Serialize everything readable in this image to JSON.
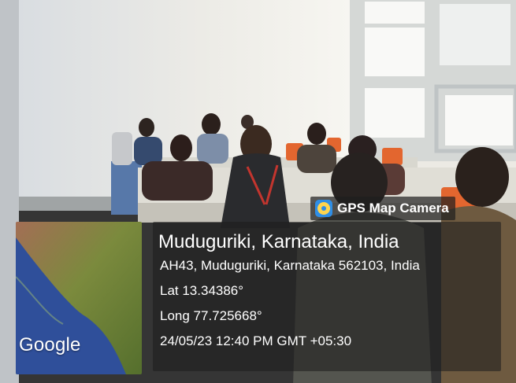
{
  "overlay": {
    "app_name": "GPS Map Camera",
    "location_title": "Muduguriki, Karnataka, India",
    "address": "AH43, Muduguriki, Karnataka 562103, India",
    "lat": "Lat 13.34386°",
    "long": "Long 77.725668°",
    "datetime": "24/05/23 12:40 PM GMT +05:30"
  },
  "map": {
    "brand": "Google"
  },
  "colors": {
    "wall": "#e7e7e1",
    "desk": "#dcdad0",
    "window_frame": "#d8dad8",
    "chair_orange": "#e3662f",
    "panel_bg": "#1c1c1c",
    "map_land": "#6f8a3b",
    "map_water": "#2f4f9a",
    "text": "#ffffff"
  },
  "icons": [
    "gps-map-camera-app-icon"
  ]
}
